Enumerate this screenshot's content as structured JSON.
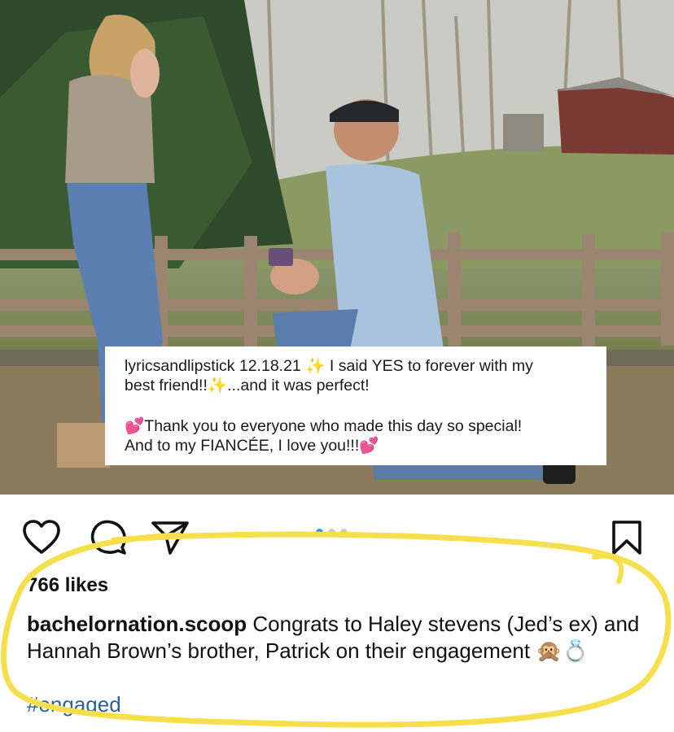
{
  "photo": {
    "caption_card": {
      "line1_user": "lyricsandlipstick",
      "line1_rest": " 12.18.21 ✨ I said YES to forever with my",
      "line2": "best friend!!✨...and it was perfect!",
      "line3": "💕Thank you to everyone who made this day so special!",
      "line4": "And to my FIANCÉE, I love you!!!💕"
    }
  },
  "actions": {
    "icons": [
      "heart-icon",
      "comment-icon",
      "share-icon",
      "bookmark-icon"
    ],
    "carousel": {
      "count": 3,
      "active_index": 0,
      "active_color": "#2196f3"
    }
  },
  "post": {
    "likes": "766 likes",
    "username": "bachelornation.scoop",
    "caption": " Congrats to Haley stevens (Jed’s ex) and Hannah Brown’s brother, Patrick on their engagement 🙊💍",
    "hashtag": "#engaged"
  },
  "colors": {
    "highlight": "#f5df4d",
    "hashtag": "#2f5f99"
  }
}
